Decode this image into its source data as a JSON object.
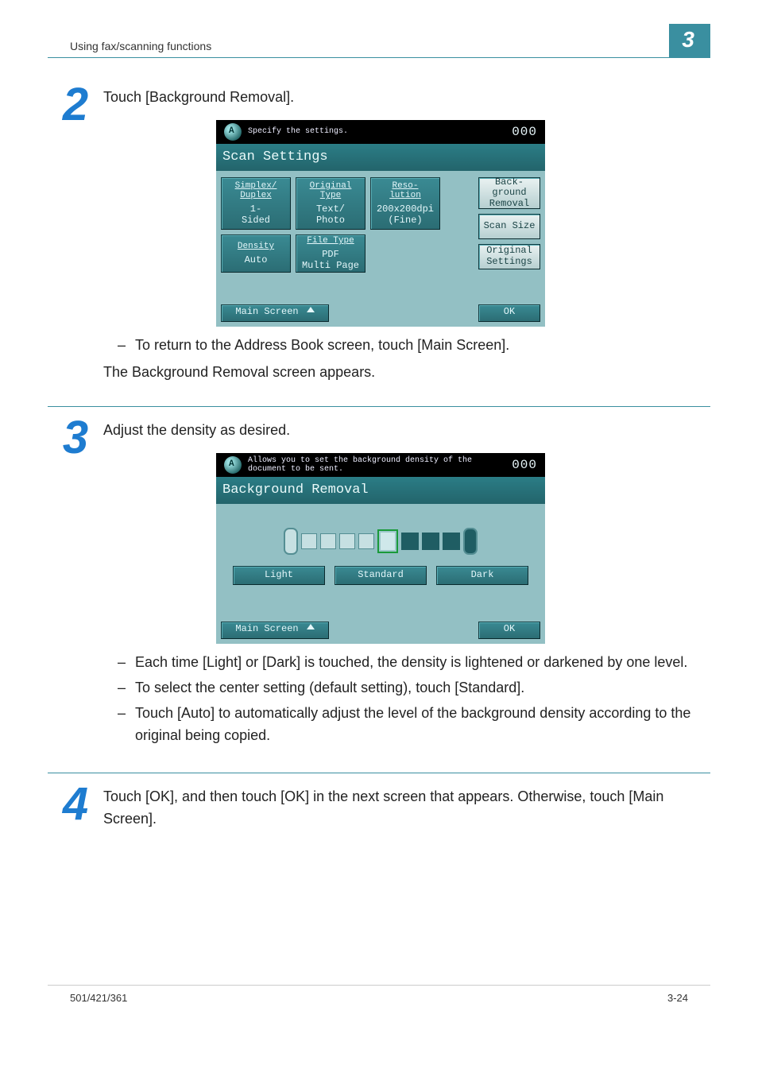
{
  "header": {
    "left": "Using fax/scanning functions",
    "right": "3"
  },
  "step2": {
    "num": "2",
    "instr": "Touch [Background Removal].",
    "after_bullet": "To return to the Address Book screen, touch [Main Screen].",
    "after_text": "The Background Removal screen appears.",
    "panel": {
      "top_text": "Specify the settings.",
      "top_right": "000",
      "title": "Scan Settings",
      "buttons": {
        "simplex_label": "Simplex/\nDuplex",
        "simplex_value": "1-\nSided",
        "original_label": "Original\nType",
        "original_value": "Text/\nPhoto",
        "reso_label": "Reso-\nlution",
        "reso_value": "200x200dpi\n(Fine)",
        "density_label": "Density",
        "density_value": "Auto",
        "filetype_label": "File Type",
        "filetype_value": "PDF\nMulti Page"
      },
      "side": {
        "bgremoval": "Back-\nground\nRemoval",
        "scansize": "Scan\nSize",
        "origset": "Original\nSettings"
      },
      "main_screen": "Main Screen",
      "ok": "OK"
    }
  },
  "step3": {
    "num": "3",
    "instr": "Adjust the density as desired.",
    "bullets": [
      "Each time [Light] or [Dark] is touched, the density is lightened or darkened by one level.",
      "To select the center setting (default setting), touch [Standard].",
      "Touch [Auto] to automatically adjust the level of the background density according to the original being copied."
    ],
    "panel": {
      "top_text": "Allows you to set the background density of the document to be sent.",
      "top_right": "000",
      "title": "Background Removal",
      "labels": {
        "light": "Light",
        "standard": "Standard",
        "dark": "Dark"
      },
      "main_screen": "Main Screen",
      "ok": "OK"
    }
  },
  "step4": {
    "num": "4",
    "instr": "Touch [OK], and then touch [OK] in the next screen that appears. Otherwise, touch [Main Screen]."
  },
  "footer": {
    "left": "501/421/361",
    "right": "3-24"
  }
}
